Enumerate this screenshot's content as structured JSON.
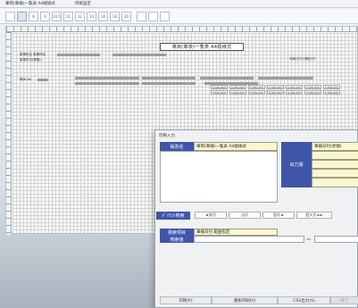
{
  "titlebar": {
    "title": "車両(車検)一覧表 A4縦様式",
    "secondary": "印刷設定"
  },
  "toolbar": {
    "buttons": [
      "",
      "",
      "8",
      "9",
      "10.5",
      "11",
      "12",
      "14",
      "16",
      "18",
      "20",
      "",
      "",
      ""
    ]
  },
  "sheet": {
    "report_title": "車両(車検)一覧表 A4縦様式",
    "header_label_1": "事業所名 事業所名",
    "header_label_2": "事業年月(期間)",
    "header_label_3": "印刷日付 印刷日付",
    "row_label": "車両 No.",
    "cell_label": "0,000,000"
  },
  "dialog": {
    "title": "印刷入力",
    "form_name_label": "帳票名",
    "form_name_value": "車両(車検)一覧表 A4縦様式",
    "output_order_label": "出力順",
    "output_order_first": "車検日付(昇順)",
    "period_label": "ﾊﾞｯﾁｽﾄ検索",
    "period_buttons": [
      "◄ 前月",
      "当月",
      "翌月 ►",
      "翌々月 ►►"
    ],
    "search_item_label": "検索項目",
    "search_item_value": "車検日付 範囲指定",
    "search_value_label": "検索値",
    "range_sep": "～",
    "buttons": {
      "print": "印刷(P)",
      "print_selected": "選択印刷(V)",
      "csv": "CSV出力(S)",
      "close": "終了"
    }
  }
}
